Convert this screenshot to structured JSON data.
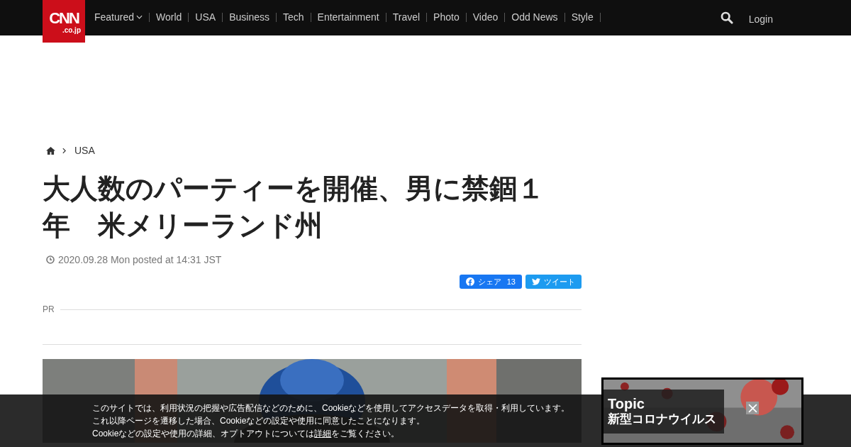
{
  "header": {
    "logo": {
      "main": "CNN",
      "sub": ".co.jp"
    },
    "nav": [
      {
        "label": "Featured",
        "dropdown": true
      },
      {
        "label": "World",
        "dropdown": false
      },
      {
        "label": "USA",
        "dropdown": false
      },
      {
        "label": "Business",
        "dropdown": false
      },
      {
        "label": "Tech",
        "dropdown": false
      },
      {
        "label": "Entertainment",
        "dropdown": false
      },
      {
        "label": "Travel",
        "dropdown": false
      },
      {
        "label": "Photo",
        "dropdown": false
      },
      {
        "label": "Video",
        "dropdown": false
      },
      {
        "label": "Odd News",
        "dropdown": false
      },
      {
        "label": "Style",
        "dropdown": false
      }
    ],
    "login": "Login"
  },
  "breadcrumb": [
    "USA"
  ],
  "article": {
    "title": "大人数のパーティーを開催、男に禁錮１年　米メリーランド州",
    "date": "2020.09.28 Mon posted at 14:31 JST",
    "share": [
      {
        "kind": "facebook",
        "label": "シェア",
        "count": "13"
      },
      {
        "kind": "twitter",
        "label": "ツイート"
      }
    ],
    "pr_label": "PR"
  },
  "topic": {
    "label": "Topic",
    "title": "新型コロナウイルス"
  },
  "cookie_notice": {
    "lines": [
      "このサイトでは、利用状況の把握や広告配信などのために、Cookieなどを使用してアクセスデータを取得・利用しています。",
      "これ以降ページを遷移した場合、Cookieなどの設定や使用に同意したことになります。"
    ],
    "last_line": {
      "before": "Cookieなどの設定や使用の詳細、オプトアウトについては",
      "link": "詳細",
      "after": "をご覧ください。"
    }
  }
}
